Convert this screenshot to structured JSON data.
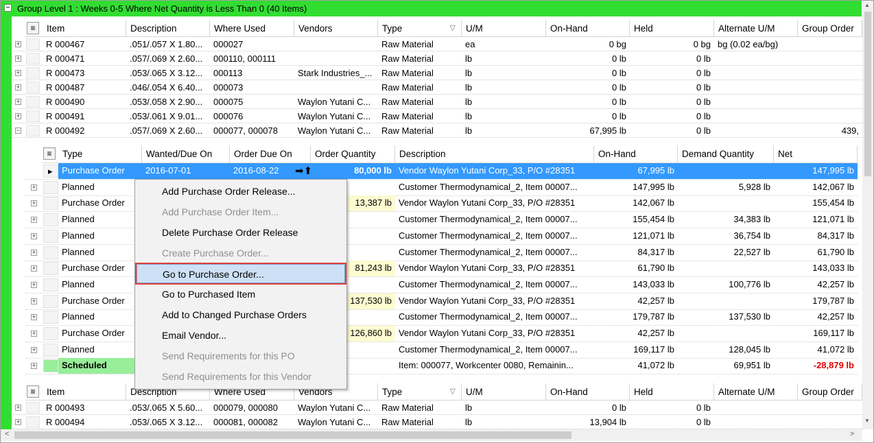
{
  "group": {
    "expander": "−",
    "title": "Group Level 1 : Weeks 0-5 Where Net Quantity is Less Than 0 (40 Items)"
  },
  "main_columns": [
    "Item",
    "Description",
    "Where Used",
    "Vendors",
    "Type",
    "U/M",
    "On-Hand",
    "Held",
    "Alternate U/M",
    "Group Order"
  ],
  "items": [
    {
      "item": "R 000467",
      "desc": ".051/.057 X 1.80...",
      "where": "000027",
      "vendors": "",
      "type": "Raw Material",
      "um": "ea",
      "onhand": "0 bg",
      "held": "0 bg",
      "alt": "bg (0.02 ea/bg)",
      "group": ""
    },
    {
      "item": "R 000471",
      "desc": ".057/.069 X 2.60...",
      "where": "000110, 000111",
      "vendors": "",
      "type": "Raw Material",
      "um": "lb",
      "onhand": "0 lb",
      "held": "0 lb",
      "alt": "",
      "group": ""
    },
    {
      "item": "R 000473",
      "desc": ".053/.065 X 3.12...",
      "where": "000113",
      "vendors": "Stark Industries_...",
      "type": "Raw Material",
      "um": "lb",
      "onhand": "0 lb",
      "held": "0 lb",
      "alt": "",
      "group": ""
    },
    {
      "item": "R 000487",
      "desc": ".046/.054 X 6.40...",
      "where": "000073",
      "vendors": "",
      "type": "Raw Material",
      "um": "lb",
      "onhand": "0 lb",
      "held": "0 lb",
      "alt": "",
      "group": ""
    },
    {
      "item": "R 000490",
      "desc": ".053/.058 X 2.90...",
      "where": "000075",
      "vendors": "Waylon Yutani C...",
      "type": "Raw Material",
      "um": "lb",
      "onhand": "0 lb",
      "held": "0 lb",
      "alt": "",
      "group": ""
    },
    {
      "item": "R 000491",
      "desc": ".053/.061 X 9.01...",
      "where": "000076",
      "vendors": "Waylon Yutani C...",
      "type": "Raw Material",
      "um": "lb",
      "onhand": "0 lb",
      "held": "0 lb",
      "alt": "",
      "group": ""
    },
    {
      "item": "R 000492",
      "desc": ".057/.069 X 2.60...",
      "where": "000077, 000078",
      "vendors": "Waylon Yutani C...",
      "type": "Raw Material",
      "um": "lb",
      "onhand": "67,995 lb",
      "held": "0 lb",
      "alt": "",
      "group": "439,"
    }
  ],
  "detail_columns": [
    "Type",
    "Wanted/Due On",
    "Order Due On",
    "Order Quantity",
    "Description",
    "On-Hand",
    "Demand Quantity",
    "Net"
  ],
  "details": [
    {
      "type": "Purchase Order",
      "wanted": "2016-07-01",
      "due": "2016-08-22",
      "qty": "80,000 lb",
      "desc": "Vendor Waylon Yutani Corp_33, P/O #28351",
      "onhand": "67,995 lb",
      "demand": "",
      "net": "147,995 lb"
    },
    {
      "type": "Planned",
      "wanted": "",
      "due": "",
      "qty": "",
      "desc": "Customer Thermodynamical_2, Item 00007...",
      "onhand": "147,995 lb",
      "demand": "5,928 lb",
      "net": "142,067 lb"
    },
    {
      "type": "Purchase Order",
      "wanted": "",
      "due": "",
      "qty": "13,387 lb",
      "desc": "Vendor Waylon Yutani Corp_33, P/O #28351",
      "onhand": "142,067 lb",
      "demand": "",
      "net": "155,454 lb"
    },
    {
      "type": "Planned",
      "wanted": "",
      "due": "",
      "qty": "",
      "desc": "Customer Thermodynamical_2, Item 00007...",
      "onhand": "155,454 lb",
      "demand": "34,383 lb",
      "net": "121,071 lb"
    },
    {
      "type": "Planned",
      "wanted": "",
      "due": "",
      "qty": "",
      "desc": "Customer Thermodynamical_2, Item 00007...",
      "onhand": "121,071 lb",
      "demand": "36,754 lb",
      "net": "84,317 lb"
    },
    {
      "type": "Planned",
      "wanted": "",
      "due": "",
      "qty": "",
      "desc": "Customer Thermodynamical_2, Item 00007...",
      "onhand": "84,317 lb",
      "demand": "22,527 lb",
      "net": "61,790 lb"
    },
    {
      "type": "Purchase Order",
      "wanted": "",
      "due": "",
      "qty": "81,243 lb",
      "desc": "Vendor Waylon Yutani Corp_33, P/O #28351",
      "onhand": "61,790 lb",
      "demand": "",
      "net": "143,033 lb"
    },
    {
      "type": "Planned",
      "wanted": "",
      "due": "",
      "qty": "",
      "desc": "Customer Thermodynamical_2, Item 00007...",
      "onhand": "143,033 lb",
      "demand": "100,776 lb",
      "net": "42,257 lb"
    },
    {
      "type": "Purchase Order",
      "wanted": "",
      "due": "",
      "qty": "137,530 lb",
      "desc": "Vendor Waylon Yutani Corp_33, P/O #28351",
      "onhand": "42,257 lb",
      "demand": "",
      "net": "179,787 lb"
    },
    {
      "type": "Planned",
      "wanted": "",
      "due": "",
      "qty": "",
      "desc": "Customer Thermodynamical_2, Item 00007...",
      "onhand": "179,787 lb",
      "demand": "137,530 lb",
      "net": "42,257 lb"
    },
    {
      "type": "Purchase Order",
      "wanted": "",
      "due": "",
      "qty": "126,860 lb",
      "desc": "Vendor Waylon Yutani Corp_33, P/O #28351",
      "onhand": "42,257 lb",
      "demand": "",
      "net": "169,117 lb"
    },
    {
      "type": "Planned",
      "wanted": "",
      "due": "",
      "qty": "",
      "desc": "Customer Thermodynamical_2, Item 00007...",
      "onhand": "169,117 lb",
      "demand": "128,045 lb",
      "net": "41,072 lb"
    },
    {
      "type": "Scheduled",
      "wanted": "",
      "due": "",
      "qty": "",
      "desc": "Item: 000077, Workcenter  0080, Remainin...",
      "onhand": "41,072 lb",
      "demand": "69,951 lb",
      "net": "-28,879 lb"
    }
  ],
  "items_bottom": [
    {
      "item": "R 000493",
      "desc": ".053/.065 X 5.60...",
      "where": "000079, 000080",
      "vendors": "Waylon Yutani C...",
      "type": "Raw Material",
      "um": "lb",
      "onhand": "0 lb",
      "held": "0 lb",
      "alt": "",
      "group": ""
    },
    {
      "item": "R 000494",
      "desc": ".053/.065 X 3.12...",
      "where": "000081, 000082",
      "vendors": "Waylon Yutani C...",
      "type": "Raw Material",
      "um": "lb",
      "onhand": "13,904 lb",
      "held": "0 lb",
      "alt": "",
      "group": ""
    }
  ],
  "context_menu": [
    {
      "label": "Add Purchase Order Release...",
      "enabled": true,
      "highlight": false
    },
    {
      "label": "Add Purchase Order Item...",
      "enabled": false,
      "highlight": false
    },
    {
      "label": "Delete Purchase Order Release",
      "enabled": true,
      "highlight": false
    },
    {
      "label": "Create Purchase Order...",
      "enabled": false,
      "highlight": false
    },
    {
      "label": "Go to Purchase Order...",
      "enabled": true,
      "highlight": true
    },
    {
      "label": "Go to Purchased Item",
      "enabled": true,
      "highlight": false
    },
    {
      "label": "Add to Changed Purchase Orders",
      "enabled": true,
      "highlight": false
    },
    {
      "label": "Email Vendor...",
      "enabled": true,
      "highlight": false
    },
    {
      "label": "Send Requirements for this PO",
      "enabled": false,
      "highlight": false
    },
    {
      "label": "Send Requirements for this Vendor",
      "enabled": false,
      "highlight": false
    }
  ],
  "glyphs": {
    "row_plus": "+",
    "row_minus": "−",
    "sort_indicator": "▽",
    "move_arrows": "➡⬆",
    "row_pointer": "▸",
    "scroll_left": "<",
    "scroll_right": ">",
    "scroll_up": "▲",
    "scroll_down": "▼",
    "chooser": "≡"
  },
  "colors": {
    "group_bar": "#32dd32",
    "selection": "#3399ff",
    "scheduled": "#99ee99",
    "highlight_outline": "#e0413a",
    "negative": "#e00000"
  }
}
